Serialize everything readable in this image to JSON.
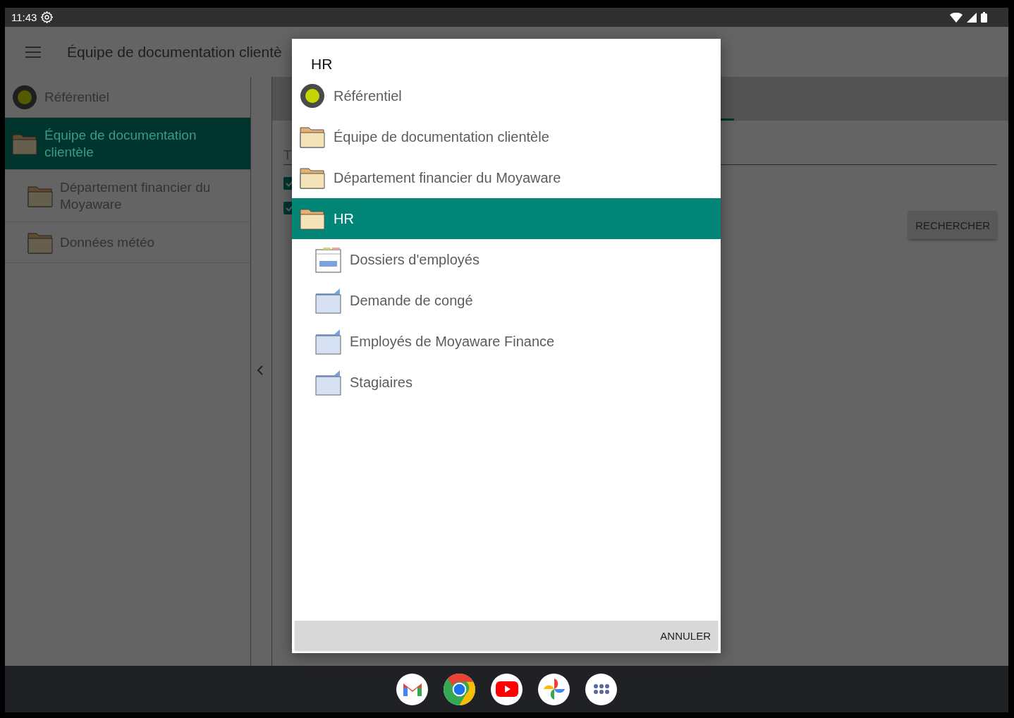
{
  "status_bar": {
    "time": "11:43"
  },
  "app_bar": {
    "title": "Équipe de documentation clientè"
  },
  "sidebar": {
    "items": [
      {
        "label": "Référentiel",
        "kind": "repository",
        "selected": false
      },
      {
        "label": "Équipe de documentation clientèle",
        "kind": "folder",
        "selected": true,
        "children": [
          {
            "label": "Département financier du Moyaware",
            "kind": "folder",
            "selected": false
          },
          {
            "label": "Données météo",
            "kind": "folder",
            "selected": false
          }
        ]
      }
    ]
  },
  "main": {
    "field_label": "T",
    "checkboxes": [
      {
        "checked": true
      },
      {
        "checked": true
      }
    ],
    "search_button": "RECHERCHER"
  },
  "dialog": {
    "title": "HR",
    "items": [
      {
        "label": "Référentiel",
        "kind": "repository",
        "selected": false
      },
      {
        "label": "Équipe de documentation clientèle",
        "kind": "folder",
        "selected": false
      },
      {
        "label": "Département financier du Moyaware",
        "kind": "folder",
        "selected": false
      },
      {
        "label": "HR",
        "kind": "folder",
        "selected": true,
        "children": [
          {
            "label": "Dossiers d'employés",
            "kind": "records",
            "selected": false
          },
          {
            "label": "Demande de congé",
            "kind": "subfolder",
            "selected": false
          },
          {
            "label": "Employés de Moyaware Finance",
            "kind": "subfolder",
            "selected": false
          },
          {
            "label": "Stagiaires",
            "kind": "subfolder",
            "selected": false
          }
        ]
      }
    ],
    "cancel_button": "ANNULER"
  },
  "dock": {
    "apps": [
      {
        "kind": "mail"
      },
      {
        "kind": "browser"
      },
      {
        "kind": "video"
      },
      {
        "kind": "photos"
      },
      {
        "kind": "apps"
      }
    ]
  }
}
